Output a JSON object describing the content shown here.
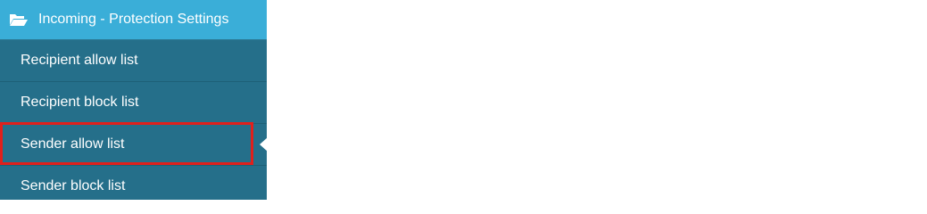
{
  "sidebar": {
    "section": {
      "icon": "folder-open-icon",
      "label": "Incoming - Protection Settings"
    },
    "items": [
      {
        "label": "Recipient allow list"
      },
      {
        "label": "Recipient block list"
      },
      {
        "label": "Sender allow list",
        "active": true,
        "highlighted": true
      },
      {
        "label": "Sender block list"
      }
    ]
  },
  "colors": {
    "header_bg": "#3aaed8",
    "sidebar_bg": "#256f8a",
    "highlight_border": "#e0201c",
    "text": "#ffffff"
  }
}
